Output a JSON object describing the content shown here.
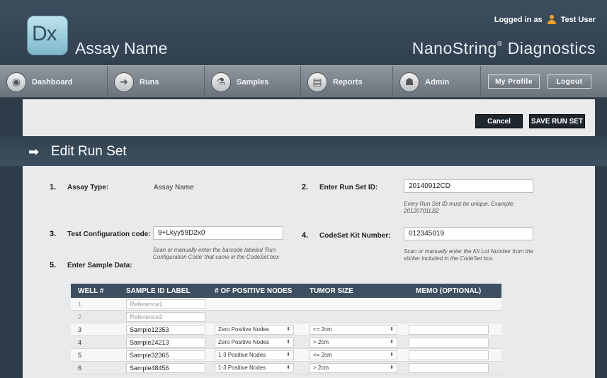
{
  "header": {
    "logo_text": "Dx",
    "assay_name": "Assay Name",
    "brand": "NanoString",
    "brand_mark": "®",
    "brand_suffix": " Diagnostics",
    "logged_in_prefix": "Logged in as",
    "user_name": "Test User"
  },
  "nav": {
    "items": [
      {
        "label": "Dashboard",
        "icon": "dashboard-icon",
        "glyph": "◉"
      },
      {
        "label": "Runs",
        "icon": "runs-icon",
        "glyph": "➜"
      },
      {
        "label": "Samples",
        "icon": "samples-icon",
        "glyph": "⚗"
      },
      {
        "label": "Reports",
        "icon": "reports-icon",
        "glyph": "▤"
      },
      {
        "label": "Admin",
        "icon": "admin-icon",
        "glyph": "☗"
      }
    ],
    "my_profile": "My Profile",
    "logout": "Logout"
  },
  "actions": {
    "cancel": "Cancel",
    "save": "SAVE RUN SET"
  },
  "page": {
    "arrow_glyph": "➡",
    "title": "Edit Run Set"
  },
  "form": {
    "assay_type": {
      "num": "1.",
      "label": "Assay Type:",
      "value": "Assay Name"
    },
    "run_set_id": {
      "num": "2.",
      "label": "Enter Run Set ID:",
      "value": "20140912CD",
      "hint_line1": "Every Run Set ID must be unique. Example:",
      "hint_line2": "20120701LB2"
    },
    "test_config": {
      "num": "3.",
      "label": "Test Configuration code:",
      "value": "9+Lkyy59D2x0",
      "hint_line1": "Scan or manually enter the barcode labeled 'Run",
      "hint_line2": "Configuration Code' that came in the CodeSet box"
    },
    "codeset_kit": {
      "num": "4.",
      "label": "CodeSet Kit Number:",
      "value": "012345019",
      "hint_line1": "Scan or manually enter the Kit Lot Number from the",
      "hint_line2": "sticker included in the CodeSet box."
    },
    "sample_data": {
      "num": "5.",
      "label": "Enter Sample Data:"
    }
  },
  "table": {
    "headers": {
      "well": "WELL #",
      "sample_id": "SAMPLE ID LABEL",
      "nodes": "# OF POSITIVE NODES",
      "tumor": "TUMOR SIZE",
      "memo": "MEMO (OPTIONAL)"
    },
    "rows": [
      {
        "well": "1",
        "sample_id": "Reference1",
        "reference": true
      },
      {
        "well": "2",
        "sample_id": "Reference2",
        "reference": true
      },
      {
        "well": "3",
        "sample_id": "Sample12353",
        "nodes": "Zero Positive Nodes",
        "tumor": "<= 2cm"
      },
      {
        "well": "4",
        "sample_id": "Sample24213",
        "nodes": "Zero Positive Nodes",
        "tumor": "> 2cm"
      },
      {
        "well": "5",
        "sample_id": "Sample32365",
        "nodes": "1-3 Positive Nodes",
        "tumor": "<= 2cm"
      },
      {
        "well": "6",
        "sample_id": "Sample48456",
        "nodes": "1-3 Positive Nodes",
        "tumor": "> 2cm"
      }
    ],
    "select_glyph": "⬍"
  }
}
